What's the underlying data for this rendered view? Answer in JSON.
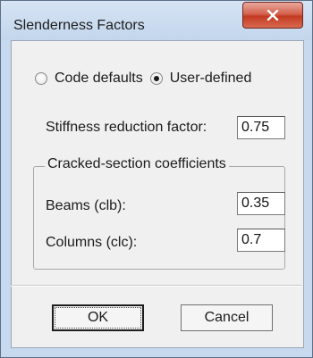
{
  "window": {
    "title": "Slenderness Factors",
    "close_icon": "close-x-icon",
    "close_color": "#c23b22"
  },
  "options": {
    "code_defaults_label": "Code defaults",
    "user_defined_label": "User-defined",
    "selected": "User-defined"
  },
  "stiffness": {
    "label": "Stiffness reduction factor:",
    "value": "0.75"
  },
  "cracked": {
    "legend": "Cracked-section coefficients",
    "beams_label": "Beams (clb):",
    "beams_value": "0.35",
    "columns_label": "Columns (clc):",
    "columns_value": "0.7"
  },
  "buttons": {
    "ok": "OK",
    "cancel": "Cancel"
  }
}
